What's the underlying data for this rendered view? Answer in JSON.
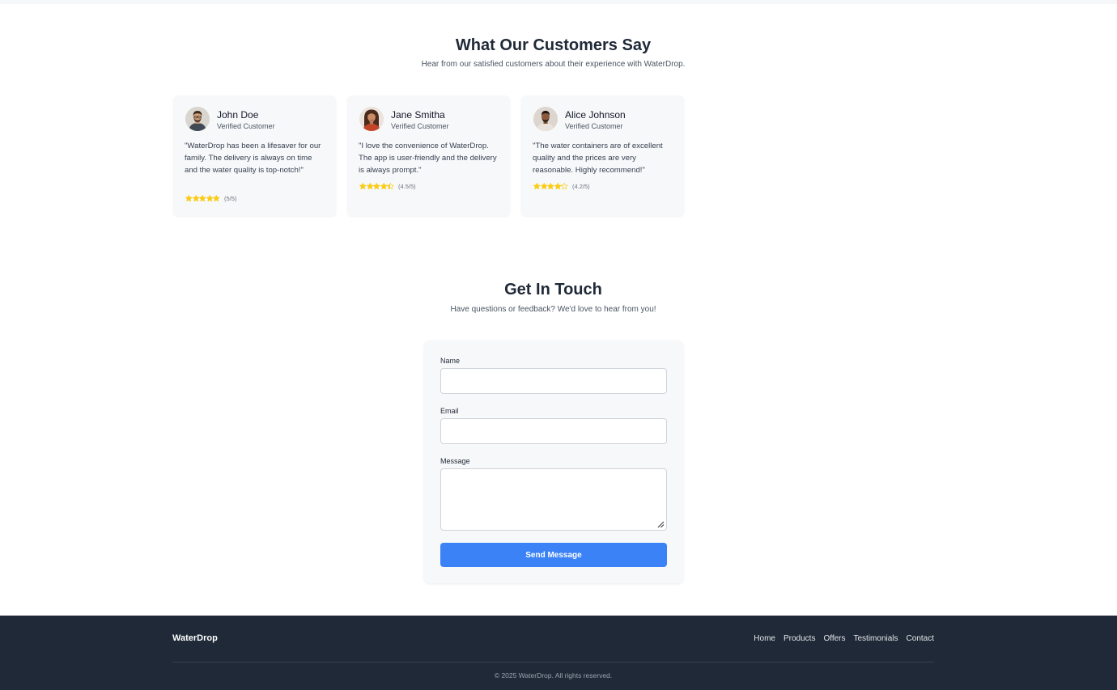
{
  "testimonials": {
    "title": "What Our Customers Say",
    "subtitle": "Hear from our satisfied customers about their experience with WaterDrop.",
    "items": [
      {
        "name": "John Doe",
        "role": "Verified Customer",
        "quote": "\"WaterDrop has been a lifesaver for our family. The delivery is always on time and the water quality is top-notch!\"",
        "rating": 5,
        "rating_label": "(5/5)"
      },
      {
        "name": "Jane Smitha",
        "role": "Verified Customer",
        "quote": "\"I love the convenience of WaterDrop. The app is user-friendly and the delivery is always prompt.\"",
        "rating": 4.5,
        "rating_label": "(4.5/5)"
      },
      {
        "name": "Alice Johnson",
        "role": "Verified Customer",
        "quote": "\"The water containers are of excellent quality and the prices are very reasonable. Highly recommend!\"",
        "rating": 4.2,
        "rating_label": "(4.2/5)"
      }
    ]
  },
  "contact": {
    "title": "Get In Touch",
    "subtitle": "Have questions or feedback? We'd love to hear from you!",
    "name_label": "Name",
    "name_value": "",
    "email_label": "Email",
    "email_value": "",
    "message_label": "Message",
    "message_value": "",
    "submit_label": "Send Message"
  },
  "footer": {
    "brand": "WaterDrop",
    "nav": [
      "Home",
      "Products",
      "Offers",
      "Testimonials",
      "Contact"
    ],
    "copyright": "© 2025 WaterDrop. All rights reserved."
  },
  "colors": {
    "accent": "#3b82f6",
    "star": "#facc15",
    "footer_bg": "#1f2937"
  }
}
